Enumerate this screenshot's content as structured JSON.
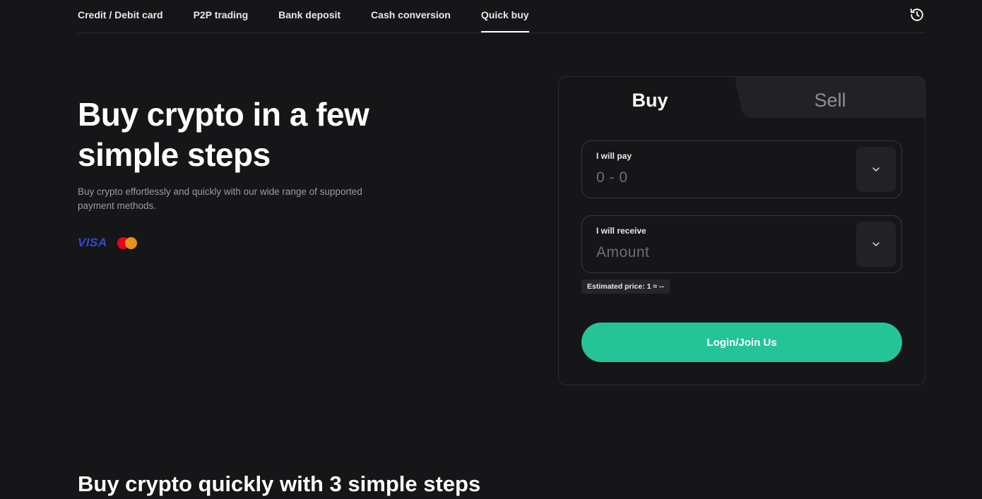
{
  "nav": {
    "tabs": [
      {
        "label": "Credit / Debit card"
      },
      {
        "label": "P2P trading"
      },
      {
        "label": "Bank deposit"
      },
      {
        "label": "Cash conversion"
      },
      {
        "label": "Quick buy"
      }
    ],
    "active_tab": "Quick buy",
    "history_icon": "history-clock-icon"
  },
  "hero": {
    "title": "Buy crypto in a few simple steps",
    "subtitle": "Buy crypto effortlessly and quickly with our wide range of supported payment methods.",
    "payment_logos": [
      "VISA",
      "mastercard"
    ]
  },
  "trade_card": {
    "tabs": {
      "buy": "Buy",
      "sell": "Sell"
    },
    "active_tab": "Buy",
    "pay": {
      "label": "I will pay",
      "placeholder": "0 - 0"
    },
    "receive": {
      "label": "I will receive",
      "placeholder": "Amount"
    },
    "estimated_price": "Estimated price: 1 ≈ --",
    "submit_label": "Login/Join Us"
  },
  "steps_section": {
    "title": "Buy crypto quickly with 3 simple steps"
  },
  "colors": {
    "background": "#161619",
    "accent": "#25c497",
    "visa_blue": "#2f4bd1",
    "mastercard_red": "#eb001b",
    "mastercard_orange": "#f79e1b"
  }
}
